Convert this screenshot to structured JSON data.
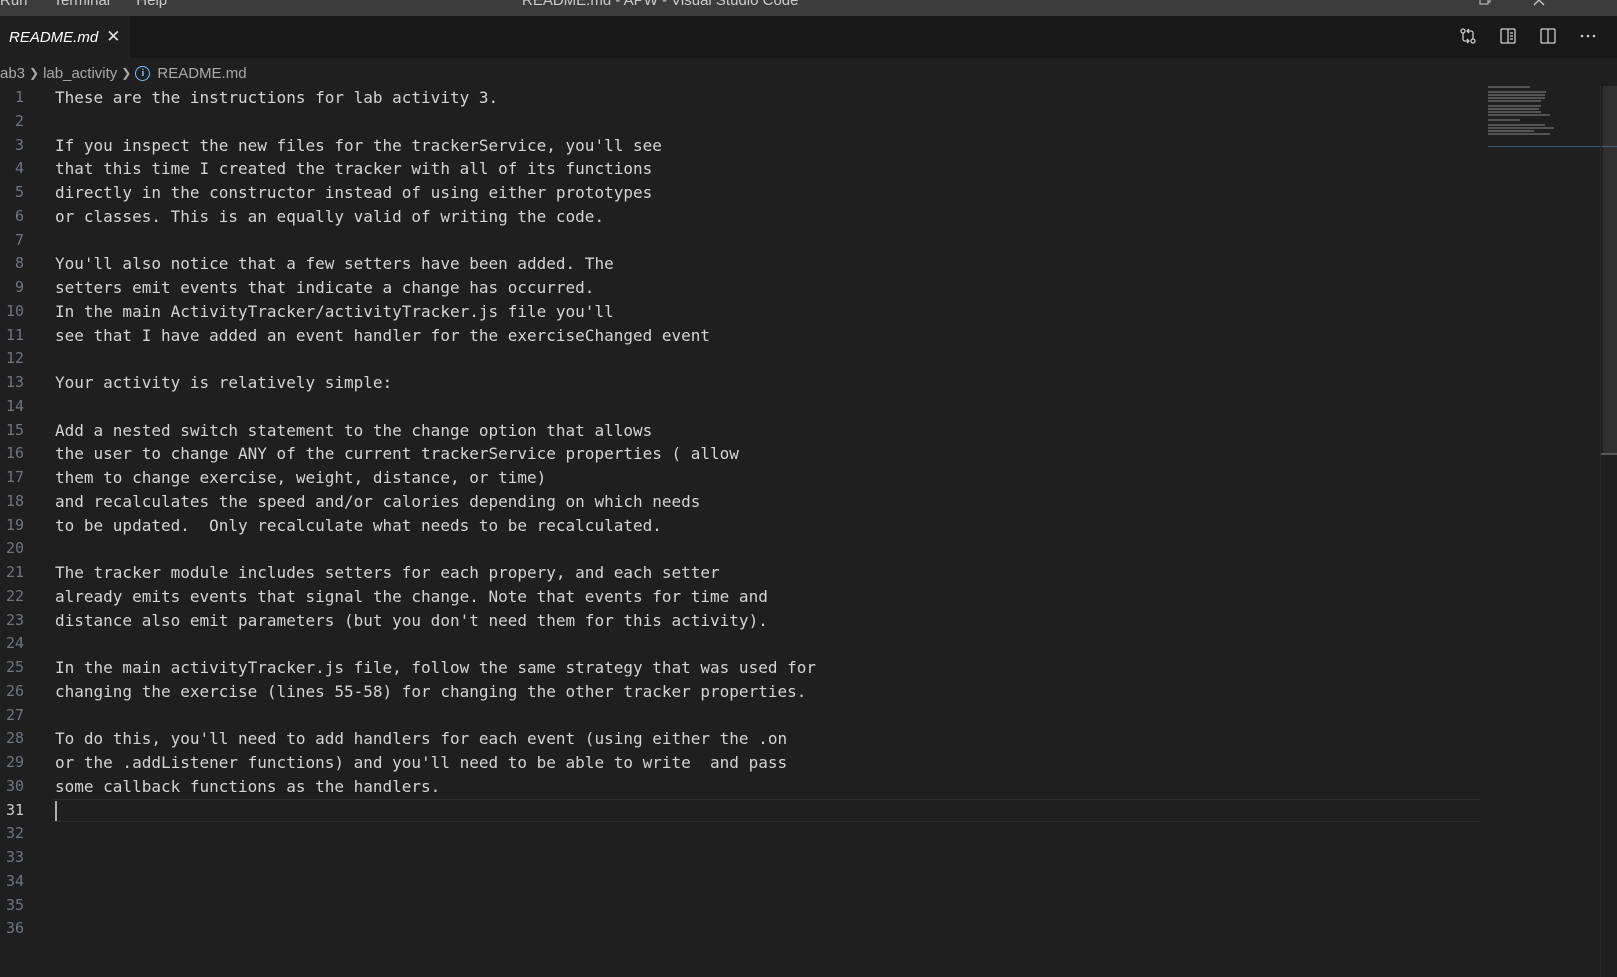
{
  "titlebar": {
    "menu": [
      "Run",
      "Terminal",
      "Help"
    ],
    "window_title": "README.md - APW - Visual Studio Code"
  },
  "tab": {
    "label": "README.md",
    "close_icon": "close-icon"
  },
  "editor_actions": [
    {
      "name": "open-changes-icon"
    },
    {
      "name": "open-preview-icon"
    },
    {
      "name": "split-editor-icon"
    },
    {
      "name": "more-actions-icon"
    }
  ],
  "breadcrumb": {
    "root": "ab3",
    "folder": "lab_activity",
    "file": "README.md"
  },
  "editor": {
    "active_line": 31,
    "lines": [
      "These are the instructions for lab activity 3.",
      "",
      "If you inspect the new files for the trackerService, you'll see",
      "that this time I created the tracker with all of its functions",
      "directly in the constructor instead of using either prototypes",
      "or classes. This is an equally valid of writing the code.",
      "",
      "You'll also notice that a few setters have been added. The",
      "setters emit events that indicate a change has occurred.",
      "In the main ActivityTracker/activityTracker.js file you'll",
      "see that I have added an event handler for the exerciseChanged event",
      "",
      "Your activity is relatively simple:",
      "",
      "Add a nested switch statement to the change option that allows",
      "the user to change ANY of the current trackerService properties ( allow",
      "them to change exercise, weight, distance, or time)",
      "and recalculates the speed and/or calories depending on which needs",
      "to be updated.  Only recalculate what needs to be recalculated.",
      "",
      "The tracker module includes setters for each propery, and each setter",
      "already emits events that signal the change. Note that events for time and",
      "distance also emit parameters (but you don't need them for this activity).",
      "",
      "In the main activityTracker.js file, follow the same strategy that was used for",
      "changing the exercise (lines 55-58) for changing the other tracker properties.",
      "",
      "To do this, you'll need to add handlers for each event (using either the .on",
      "or the .addListener functions) and you'll need to be able to write  and pass",
      "some callback functions as the handlers.",
      "",
      "",
      "",
      "",
      "",
      ""
    ]
  }
}
